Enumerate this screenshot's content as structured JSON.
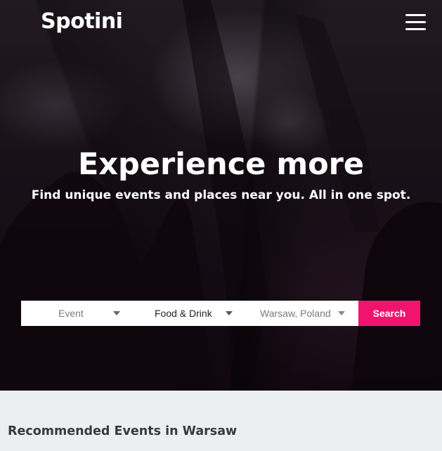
{
  "header": {
    "logo_text": "Spotini",
    "menu_icon": "hamburger-menu-icon"
  },
  "hero": {
    "headline": "Experience more",
    "subheadline": "Find unique events and places near you. All in one spot."
  },
  "search": {
    "type_select": {
      "value": "Event",
      "icon": "caret-down-icon"
    },
    "category_select": {
      "value": "Food & Drink",
      "icon": "caret-down-icon"
    },
    "location_select": {
      "value": "Warsaw, Poland",
      "icon": "caret-down-icon"
    },
    "button_label": "Search",
    "button_color": "#f0146e"
  },
  "recommended": {
    "title": "Recommended Events in Warsaw"
  }
}
